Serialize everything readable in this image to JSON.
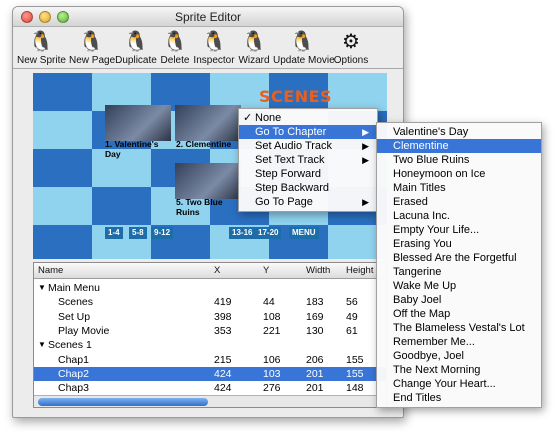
{
  "window": {
    "title": "Sprite Editor"
  },
  "toolbar": [
    {
      "label": "New Sprite",
      "icon": "penguin-new-sprite-icon",
      "glyph": "🐧"
    },
    {
      "label": "New Page",
      "icon": "penguin-new-page-icon",
      "glyph": "🐧"
    },
    {
      "label": "Duplicate",
      "icon": "penguins-duplicate-icon",
      "glyph": "🐧"
    },
    {
      "label": "Delete",
      "icon": "penguin-delete-icon",
      "glyph": "🐧"
    },
    {
      "label": "Inspector",
      "icon": "penguin-inspector-icon",
      "glyph": "🐧"
    },
    {
      "label": "Wizard",
      "icon": "penguin-wizard-icon",
      "glyph": "🐧"
    },
    {
      "label": "Update Movie",
      "icon": "penguin-update-movie-icon",
      "glyph": "🐧"
    },
    {
      "label": "Options",
      "icon": "options-sliders-icon",
      "glyph": "⚙"
    }
  ],
  "preview": {
    "title": "SCENES",
    "thumbnails": [
      {
        "label": "1. Valentine's Day"
      },
      {
        "label": "2. Clementine"
      },
      {
        "label": "5. Two Blue Ruins"
      }
    ],
    "nav": [
      "1-4",
      "5-8",
      "9-12",
      "13-16",
      "17-20",
      "MENU"
    ]
  },
  "table": {
    "columns": [
      "Name",
      "X",
      "Y",
      "Width",
      "Height"
    ],
    "rows": [
      {
        "name": "Main Menu",
        "group": true,
        "x": "",
        "y": "",
        "w": "",
        "h": ""
      },
      {
        "name": "Scenes",
        "group": false,
        "x": "419",
        "y": "44",
        "w": "183",
        "h": "56"
      },
      {
        "name": "Set Up",
        "group": false,
        "x": "398",
        "y": "108",
        "w": "169",
        "h": "49"
      },
      {
        "name": "Play Movie",
        "group": false,
        "x": "353",
        "y": "221",
        "w": "130",
        "h": "61"
      },
      {
        "name": "Scenes 1",
        "group": true,
        "x": "",
        "y": "",
        "w": "",
        "h": ""
      },
      {
        "name": "Chap1",
        "group": false,
        "x": "215",
        "y": "106",
        "w": "206",
        "h": "155"
      },
      {
        "name": "Chap2",
        "group": false,
        "selected": true,
        "x": "424",
        "y": "103",
        "w": "201",
        "h": "155"
      },
      {
        "name": "Chap3",
        "group": false,
        "x": "424",
        "y": "276",
        "w": "201",
        "h": "148"
      }
    ]
  },
  "context_menu": {
    "items": [
      {
        "label": "None",
        "checked": true,
        "submenu": false
      },
      {
        "label": "Go To Chapter",
        "highlighted": true,
        "submenu": true
      },
      {
        "label": "Set Audio Track",
        "submenu": true
      },
      {
        "label": "Set Text Track",
        "submenu": true
      },
      {
        "label": "Step Forward",
        "submenu": false
      },
      {
        "label": "Step Backward",
        "submenu": false
      },
      {
        "label": "Go To Page",
        "submenu": true
      }
    ],
    "check_glyph": "✓",
    "arrow_glyph": "▶"
  },
  "chapter_menu": {
    "items": [
      "Valentine's Day",
      "Clementine",
      "Two Blue Ruins",
      "Honeymoon on Ice",
      "Main Titles",
      "Erased",
      "Lacuna Inc.",
      "Empty Your Life...",
      "Erasing You",
      "Blessed Are the Forgetful",
      "Tangerine",
      "Wake Me Up",
      "Baby Joel",
      "Off the Map",
      "The Blameless Vestal's Lot",
      "Remember Me...",
      "Goodbye, Joel",
      "The Next Morning",
      "Change Your Heart...",
      "End Titles"
    ],
    "highlighted_index": 1
  },
  "colors": {
    "selection": "#3875d7",
    "movie_bg": "#58b8e0",
    "scenes_title": "#e76020"
  }
}
